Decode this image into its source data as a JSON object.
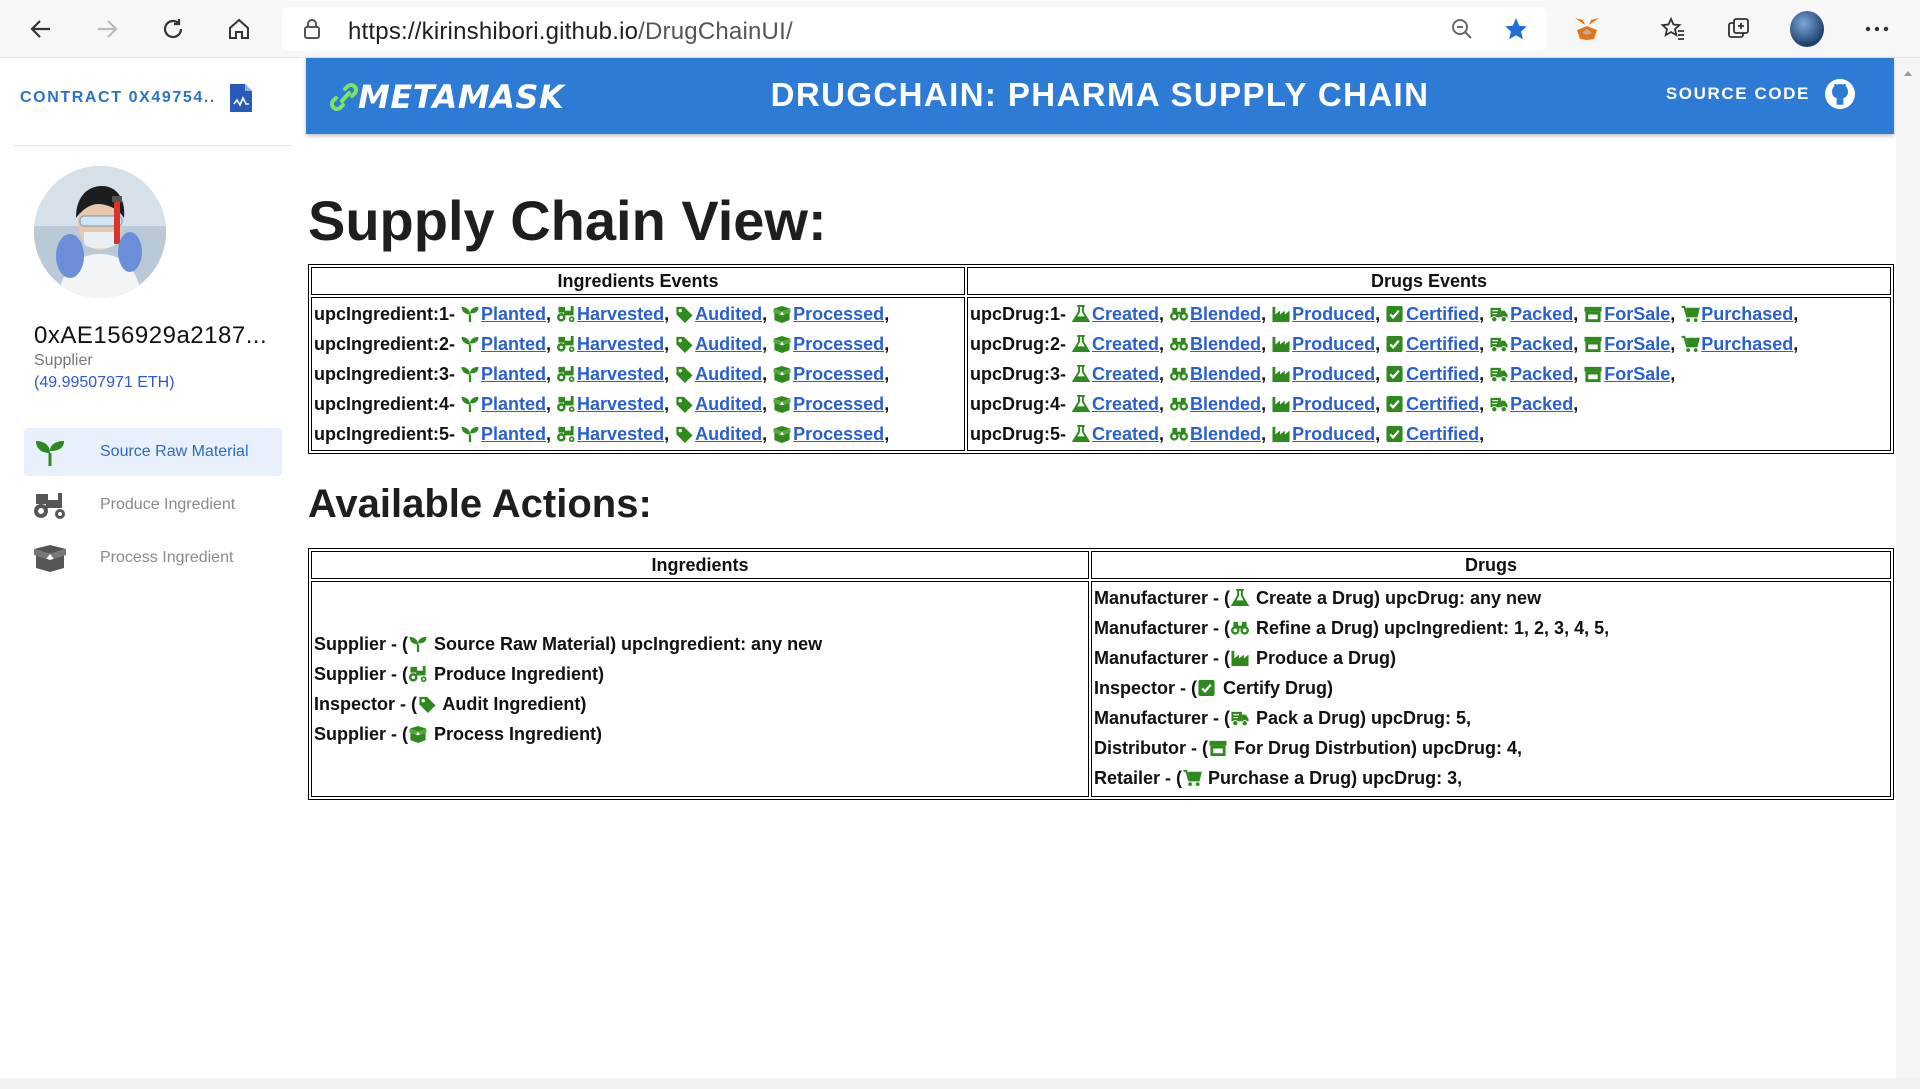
{
  "browser": {
    "url_host": "https://kirinshibori.github.io",
    "url_path": "/DrugChainUI/"
  },
  "sidebar": {
    "contract_label": "CONTRACT 0X49754..",
    "account_address": "0xAE156929a2187...",
    "role": "Supplier",
    "balance": "(49.99507971 ETH)",
    "menu": [
      {
        "label": "Source Raw Material",
        "icon": "sprout-icon",
        "active": true
      },
      {
        "label": "Produce Ingredient",
        "icon": "tractor-icon",
        "active": false
      },
      {
        "label": "Process Ingredient",
        "icon": "box-open-icon",
        "active": false
      }
    ]
  },
  "header": {
    "logo": "METAMASK",
    "title": "DRUGCHAIN: PHARMA SUPPLY CHAIN",
    "source_code": "SOURCE CODE"
  },
  "supply_view": {
    "title": "Supply Chain View:",
    "ingredients_header": "Ingredients Events",
    "drugs_header": "Drugs Events",
    "ingredients": [
      {
        "label": "upcIngredient:1-",
        "events": [
          "Planted",
          "Harvested",
          "Audited",
          "Processed"
        ]
      },
      {
        "label": "upcIngredient:2-",
        "events": [
          "Planted",
          "Harvested",
          "Audited",
          "Processed"
        ]
      },
      {
        "label": "upcIngredient:3-",
        "events": [
          "Planted",
          "Harvested",
          "Audited",
          "Processed"
        ]
      },
      {
        "label": "upcIngredient:4-",
        "events": [
          "Planted",
          "Harvested",
          "Audited",
          "Processed"
        ]
      },
      {
        "label": "upcIngredient:5-",
        "events": [
          "Planted",
          "Harvested",
          "Audited",
          "Processed"
        ]
      }
    ],
    "drugs": [
      {
        "label": "upcDrug:1-",
        "events": [
          "Created",
          "Blended",
          "Produced",
          "Certified",
          "Packed",
          "ForSale",
          "Purchased"
        ]
      },
      {
        "label": "upcDrug:2-",
        "events": [
          "Created",
          "Blended",
          "Produced",
          "Certified",
          "Packed",
          "ForSale",
          "Purchased"
        ]
      },
      {
        "label": "upcDrug:3-",
        "events": [
          "Created",
          "Blended",
          "Produced",
          "Certified",
          "Packed",
          "ForSale"
        ]
      },
      {
        "label": "upcDrug:4-",
        "events": [
          "Created",
          "Blended",
          "Produced",
          "Certified",
          "Packed"
        ]
      },
      {
        "label": "upcDrug:5-",
        "events": [
          "Created",
          "Blended",
          "Produced",
          "Certified"
        ]
      }
    ]
  },
  "actions": {
    "title": "Available Actions:",
    "ingredients_header": "Ingredients",
    "drugs_header": "Drugs",
    "ingredients": [
      {
        "actor": "Supplier - (",
        "icon": "Planted",
        "text": " Source Raw Material) upcIngredient: any new"
      },
      {
        "actor": "Supplier - (",
        "icon": "Harvested",
        "text": " Produce Ingredient)"
      },
      {
        "actor": "Inspector - (",
        "icon": "Audited",
        "text": " Audit Ingredient)"
      },
      {
        "actor": "Supplier - (",
        "icon": "Processed",
        "text": " Process Ingredient)"
      }
    ],
    "drugs": [
      {
        "actor": "Manufacturer - (",
        "icon": "Created",
        "text": " Create a Drug) upcDrug: any new"
      },
      {
        "actor": "Manufacturer - (",
        "icon": "Blended",
        "text": " Refine a Drug) upcIngredient: 1, 2, 3, 4, 5,"
      },
      {
        "actor": "Manufacturer - (",
        "icon": "Produced",
        "text": " Produce a Drug)"
      },
      {
        "actor": "Inspector - (",
        "icon": "Certified",
        "text": " Certify Drug)"
      },
      {
        "actor": "Manufacturer - (",
        "icon": "Packed",
        "text": " Pack a Drug) upcDrug: 5,"
      },
      {
        "actor": "Distributor - (",
        "icon": "ForSale",
        "text": " For Drug Distrbution) upcDrug: 4,"
      },
      {
        "actor": "Retailer - (",
        "icon": "Purchased",
        "text": " Purchase a Drug) upcDrug: 3,"
      }
    ]
  },
  "colors": {
    "accent": "#2e7bd6",
    "icon_green": "#2f8a1e",
    "link": "#2a5fd0"
  }
}
